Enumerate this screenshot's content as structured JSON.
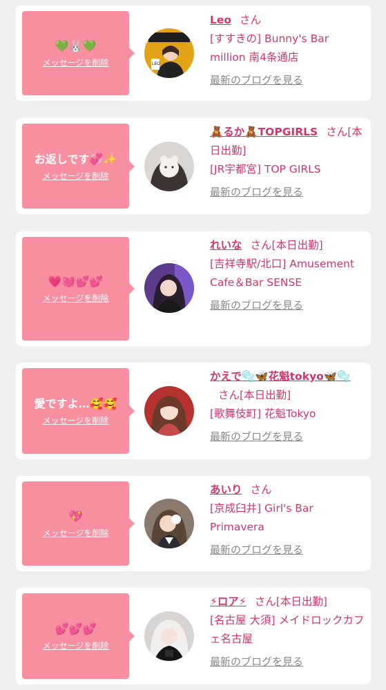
{
  "colors": {
    "page_bg": "#efefef",
    "card_bg": "#ffffff",
    "bubble_pink": "#f78fa1",
    "name_magenta": "#d6336c",
    "link_gray": "#888888"
  },
  "messages": [
    {
      "message": "💚🐰💚",
      "delete_label": "メッセージを削除",
      "name": "Leo",
      "honorific": "さん",
      "status": "",
      "shop": "[すすきの] Bunny's Bar million 南4条通店",
      "blog_label": "最新のブログを見る",
      "avatar_icon": "profile-photo"
    },
    {
      "message": "お返しです💞✨",
      "delete_label": "メッセージを削除",
      "name": "🧸るか🧸TOPGIRLS",
      "honorific": "さん",
      "status": "[本日出勤]",
      "shop": "[JR宇都宮] TOP GIRLS",
      "blog_label": "最新のブログを見る",
      "avatar_icon": "profile-photo"
    },
    {
      "message": "💗💓💕💕",
      "delete_label": "メッセージを削除",
      "name": "れいな",
      "honorific": "さん",
      "status": "[本日出勤]",
      "shop": "[吉祥寺駅/北口] Amusement Cafe＆Bar SENSE",
      "blog_label": "最新のブログを見る",
      "avatar_icon": "profile-photo"
    },
    {
      "message": "愛ですよ…🥰🥰",
      "delete_label": "メッセージを削除",
      "name": "かえで🫧🦋花魁tokyo🦋🫧",
      "honorific": "さん",
      "status": "[本日出勤]",
      "shop": "[歌舞伎町] 花魁Tokyo",
      "blog_label": "最新のブログを見る",
      "avatar_icon": "profile-photo"
    },
    {
      "message": "💖",
      "delete_label": "メッセージを削除",
      "name": "あいり",
      "honorific": "さん",
      "status": "",
      "shop": "[京成臼井] Girl's Bar Primavera",
      "blog_label": "最新のブログを見る",
      "avatar_icon": "profile-photo"
    },
    {
      "message": "💕💕💕",
      "delete_label": "メッセージを削除",
      "name": "⚡ロア⚡",
      "honorific": "さん",
      "status": "[本日出勤]",
      "shop": "[名古屋 大須] メイドロックカフェ名古屋",
      "blog_label": "最新のブログを見る",
      "avatar_icon": "profile-photo"
    }
  ]
}
